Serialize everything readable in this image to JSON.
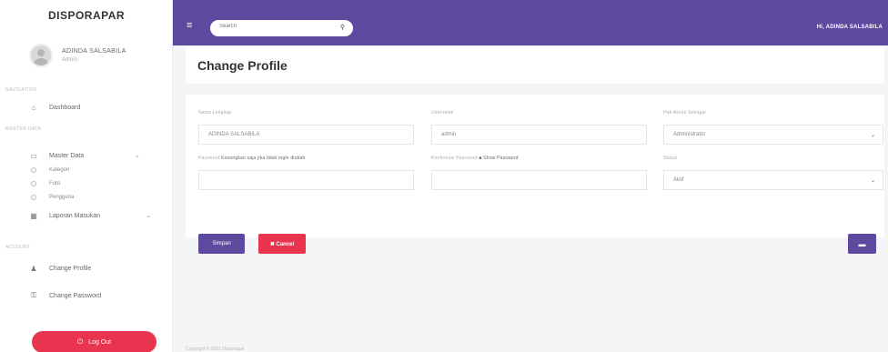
{
  "app": {
    "brand": "DISPORAPAR"
  },
  "user": {
    "name": "ADINDA SALSABILA",
    "role": "Admin"
  },
  "sidebar": {
    "section_main": "NAVIGATION",
    "dashboard": "Dashboard",
    "section_data": "MASTER DATA",
    "master_data": "Master Data",
    "sub_items": [
      {
        "label": "Kategori"
      },
      {
        "label": "Foto"
      },
      {
        "label": "Pengguna"
      }
    ],
    "laporan": "Laporan Masukan",
    "section_account": "ACCOUNT",
    "change_profile": "Change Profile",
    "change_password": "Change Password",
    "logout": "Log Out"
  },
  "topbar": {
    "search_placeholder": "Search",
    "greeting": "Hi, ADINDA SALSABILA"
  },
  "page": {
    "title": "Change Profile"
  },
  "form": {
    "name_label": "Nama Lengkap",
    "name_value": "ADINDA SALSABILA",
    "username_label": "Username",
    "username_value": "admin",
    "role_label": "Hak Akses Sebagai",
    "role_value": "Administrator",
    "password_label": "Password",
    "password_hint": "Kosongkan saja jika tidak ingin diubah",
    "password_value": "",
    "confirm_label": "Konfirmasi Password",
    "confirm_hint": "Show Password",
    "confirm_value": "",
    "status_label": "Status",
    "status_value": "Aktif",
    "save_label": "Simpan",
    "cancel_label": "✖ Cancel"
  },
  "footer": {
    "text": "Copyright © 2021 Disporapar"
  },
  "colors": {
    "primary": "#5d4a9e",
    "danger": "#e8344e",
    "background": "#f4f5f7"
  },
  "icons": {
    "dashboard": "home-icon",
    "master_data": "folder-icon",
    "laporan": "report-icon",
    "change_profile": "user-icon",
    "change_password": "lock-icon",
    "logout": "power-icon",
    "search": "search-icon",
    "menu": "hamburger-icon"
  }
}
